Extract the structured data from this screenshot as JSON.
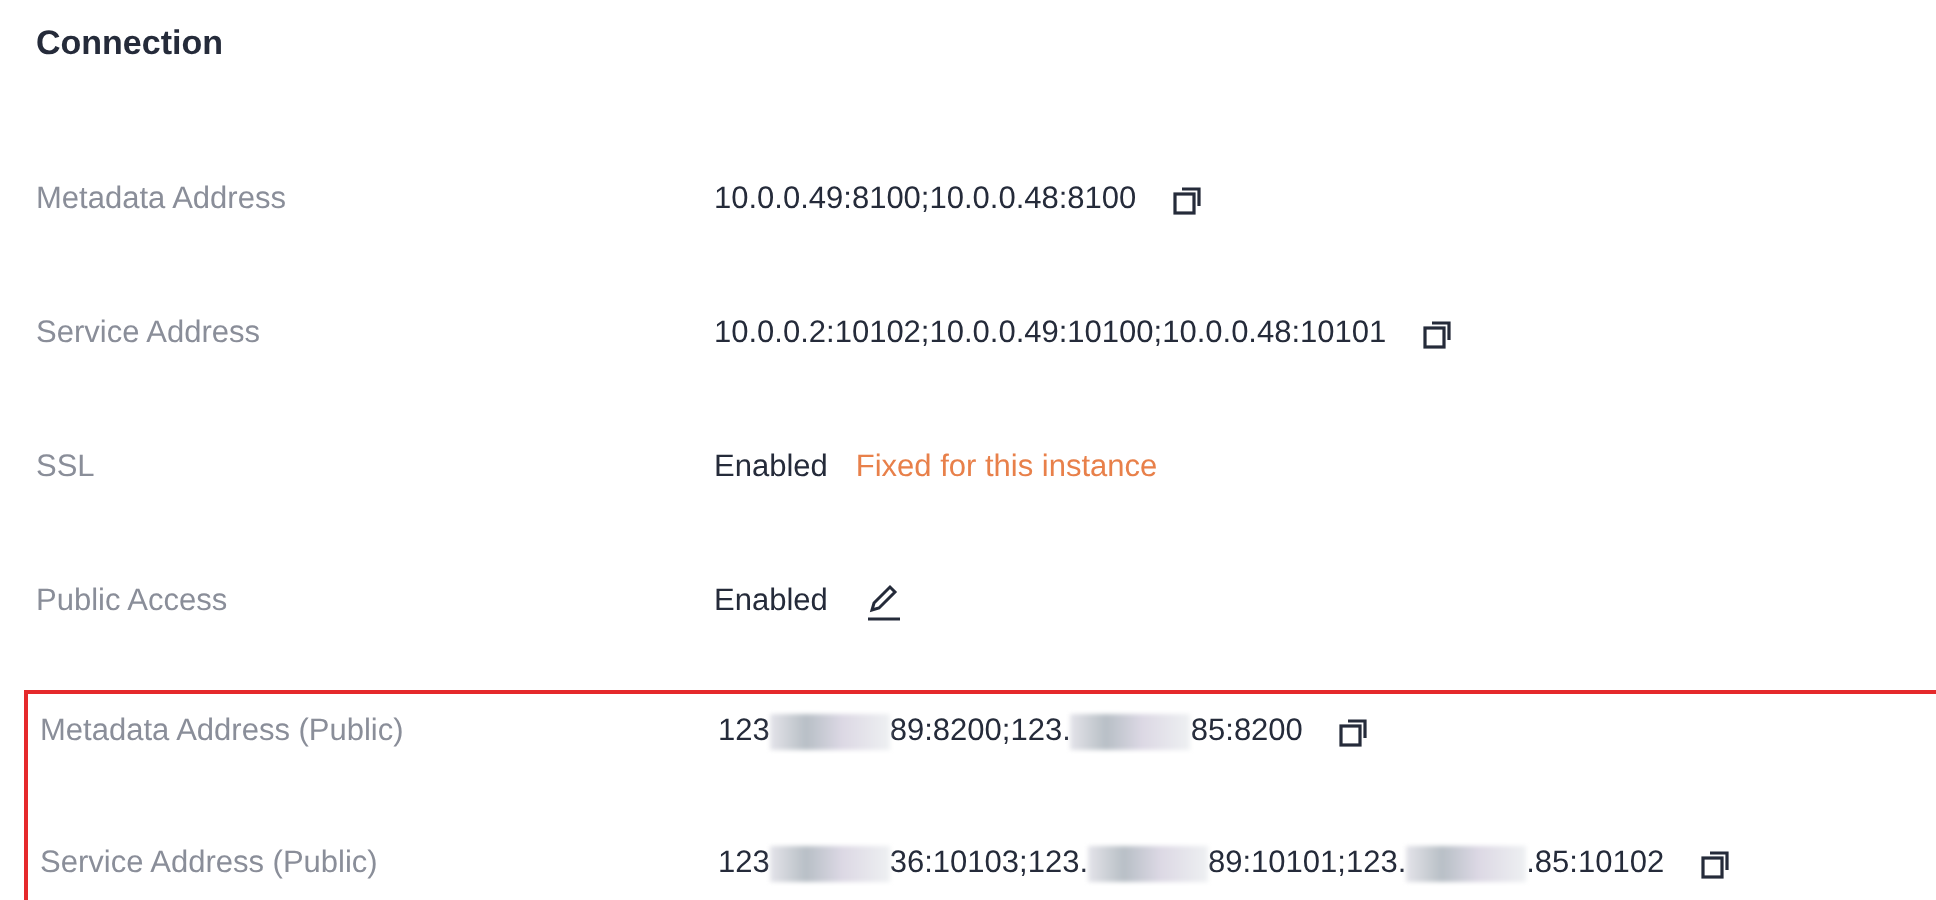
{
  "section": {
    "title": "Connection"
  },
  "rows": [
    {
      "label": "Metadata Address",
      "value": "10.0.0.49:8100;10.0.0.48:8100",
      "copyable": true
    },
    {
      "label": "Service Address",
      "value": "10.0.0.2:10102;10.0.0.49:10100;10.0.0.48:10101",
      "copyable": true
    },
    {
      "label": "SSL",
      "value": "Enabled",
      "note": "Fixed for this instance"
    },
    {
      "label": "Public Access",
      "value": "Enabled",
      "editable": true
    }
  ],
  "highlighted_rows": [
    {
      "label": "Metadata Address (Public)",
      "copyable": true,
      "parts": [
        {
          "kind": "text",
          "text": "123"
        },
        {
          "kind": "redacted"
        },
        {
          "kind": "text",
          "text": "89:8200;123."
        },
        {
          "kind": "redacted"
        },
        {
          "kind": "text",
          "text": "85:8200"
        }
      ]
    },
    {
      "label": "Service Address (Public)",
      "copyable": true,
      "parts": [
        {
          "kind": "text",
          "text": "123"
        },
        {
          "kind": "redacted"
        },
        {
          "kind": "text",
          "text": "36:10103;123."
        },
        {
          "kind": "redacted"
        },
        {
          "kind": "text",
          "text": "89:10101;123."
        },
        {
          "kind": "redacted"
        },
        {
          "kind": "text",
          "text": ".85:10102"
        }
      ]
    }
  ]
}
